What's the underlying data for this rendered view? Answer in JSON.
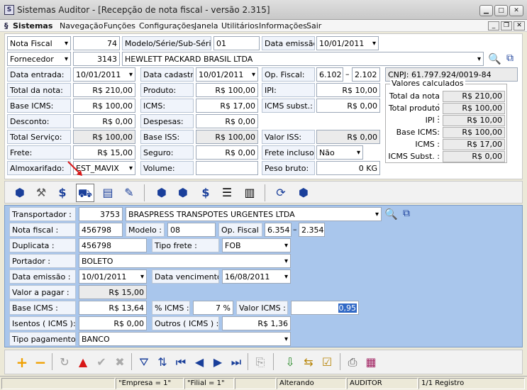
{
  "window": {
    "title": "Sistemas Auditor - [Recepção de nota fiscal - versão 2.315]",
    "app_icon": "S"
  },
  "menu": {
    "items": [
      "Sistemas",
      "Navegação",
      "Funções",
      "Configurações",
      "Janela",
      "Utilitários",
      "Informações",
      "Sair"
    ]
  },
  "header": {
    "nota_label": "Nota Fiscal",
    "nota_value": "74",
    "modelo_label": "Modelo/Série/Sub-Série:",
    "modelo_value": "01",
    "data_emissao_label": "Data emissão:",
    "data_emissao_value": "10/01/2011",
    "fornecedor_label": "Fornecedor",
    "fornecedor_code": "3143",
    "fornecedor_name": "HEWLETT PACKARD BRASIL LTDA",
    "data_entrada_label": "Data entrada:",
    "data_entrada_value": "10/01/2011",
    "data_cadastro_label": "Data cadastro:",
    "data_cadastro_value": "10/01/2011",
    "op_fiscal_label": "Op. Fiscal:",
    "op_fiscal_1": "6.102",
    "op_fiscal_2": "2.102",
    "op_sep": "–",
    "cnpj": "CNPJ: 61.797.924/0019-84",
    "total_nota_label": "Total da nota:",
    "total_nota_value": "R$ 210,00",
    "produto_label": "Produto:",
    "produto_value": "R$ 100,00",
    "ipi_label": "IPI:",
    "ipi_value": "R$ 10,00",
    "base_icms_label": "Base ICMS:",
    "base_icms_value": "R$ 100,00",
    "icms_label": "ICMS:",
    "icms_value": "R$ 17,00",
    "icms_subst_label": "ICMS subst.:",
    "icms_subst_value": "R$ 0,00",
    "desconto_label": "Desconto:",
    "desconto_value": "R$ 0,00",
    "despesas_label": "Despesas:",
    "despesas_value": "R$ 0,00",
    "total_servico_label": "Total Serviço:",
    "total_servico_value": "R$ 100,00",
    "base_iss_label": "Base ISS:",
    "base_iss_value": "R$ 100,00",
    "valor_iss_label": "Valor ISS:",
    "valor_iss_value": "R$ 0,00",
    "frete_label": "Frete:",
    "frete_value": "R$ 15,00",
    "seguro_label": "Seguro:",
    "seguro_value": "R$ 0,00",
    "frete_incluso_label": "Frete incluso:",
    "frete_incluso_value": "Não",
    "almox_label": "Almoxarifado:",
    "almox_value": "EST_MAVIX",
    "volume_label": "Volume:",
    "volume_value": "",
    "peso_label": "Peso bruto:",
    "peso_value": "0 KG"
  },
  "calc": {
    "caption": "Valores calculados",
    "rows": [
      {
        "label": "Total da nota :",
        "value": "R$ 210,00"
      },
      {
        "label": "Total produto :",
        "value": "R$ 100,00"
      },
      {
        "label": "IPI :",
        "value": "R$ 10,00"
      },
      {
        "label": "Base ICMS:",
        "value": "R$ 100,00"
      },
      {
        "label": "ICMS :",
        "value": "R$ 17,00"
      },
      {
        "label": "ICMS Subst. :",
        "value": "R$ 0,00"
      }
    ]
  },
  "transport": {
    "transportador_label": "Transportador :",
    "transportador_code": "3753",
    "transportador_name": "BRASPRESS TRANSPOTES URGENTES LTDA",
    "nota_label": "Nota fiscal :",
    "nota_value": "456798",
    "modelo_label": "Modelo :",
    "modelo_value": "08",
    "op_label": "Op. Fiscal :",
    "op_1": "6.354",
    "op_2": "2.354",
    "op_sep": "–",
    "duplicata_label": "Duplicata :",
    "duplicata_value": "456798",
    "tipo_frete_label": "Tipo frete :",
    "tipo_frete_value": "FOB",
    "portador_label": "Portador :",
    "portador_value": "BOLETO",
    "emissao_label": "Data emissão :",
    "emissao_value": "10/01/2011",
    "vencimento_label": "Data vencimento :",
    "vencimento_value": "16/08/2011",
    "valor_label": "Valor a pagar :",
    "valor_value": "R$ 15,00",
    "base_icms_label": "Base ICMS :",
    "base_icms_value": "R$ 13,64",
    "perc_icms_label": "% ICMS :",
    "perc_icms_value": "7 %",
    "valor_icms_label": "Valor ICMS :",
    "valor_icms_value": "0,95",
    "isentos_label": "Isentos ( ICMS ):",
    "isentos_value": "R$ 0,00",
    "outros_label": "Outros ( ICMS ) :",
    "outros_value": "R$ 1,36",
    "tipo_pag_label": "Tipo pagamento:",
    "tipo_pag_value": "BANCO"
  },
  "status": {
    "c1": "",
    "c2": "\"Empresa = 1\"",
    "c3": "\"Filial = 1\"",
    "c4": "",
    "c5": "Alterando",
    "c6": "AUDITOR",
    "c7": "1/1 Registro"
  },
  "colors": {
    "main_bg": "#a9c6ec",
    "selection": "#3169c6",
    "add": "#f0a000",
    "warning": "#d81818"
  }
}
